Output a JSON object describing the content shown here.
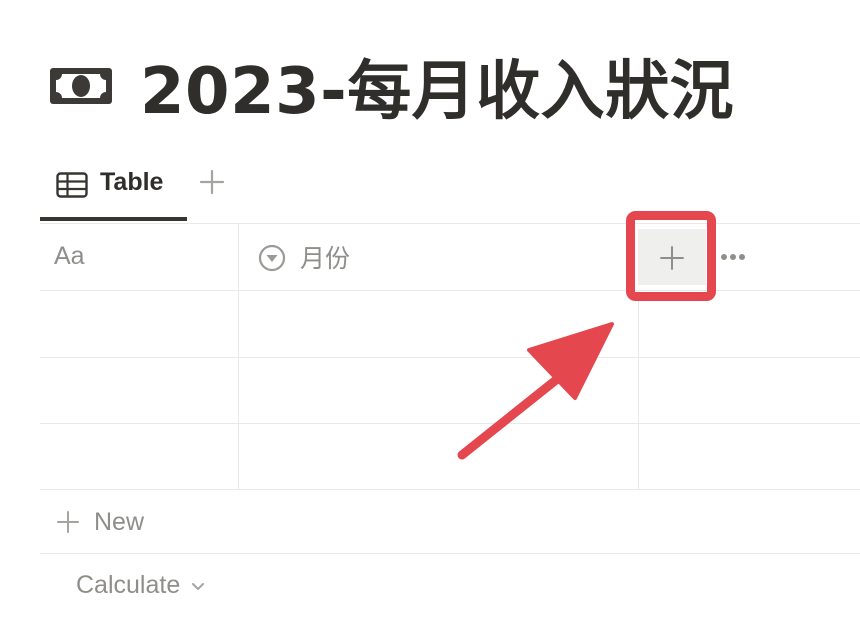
{
  "page": {
    "title": "2023-每月收入狀況",
    "title_icon": "banknote-icon"
  },
  "views": {
    "tabs": [
      {
        "label": "Table",
        "icon": "table-icon",
        "active": true
      }
    ],
    "add_view_icon": "plus-icon"
  },
  "table": {
    "columns": [
      {
        "label": "Aa",
        "type": "title"
      },
      {
        "label": "月份",
        "type": "select",
        "icon": "select-icon"
      }
    ],
    "add_property_icon": "plus-icon",
    "more_icon": "more-horizontal-icon",
    "rows": [
      {
        "name": "",
        "month": ""
      },
      {
        "name": "",
        "month": ""
      },
      {
        "name": "",
        "month": ""
      }
    ],
    "new_label": "New",
    "calculate_label": "Calculate"
  },
  "annotation": {
    "highlight_color": "#e5474f",
    "arrow_color": "#e5474f"
  },
  "colors": {
    "text_primary": "#37352f",
    "text_secondary": "#8f8e8a",
    "border": "#e9e9e7"
  }
}
